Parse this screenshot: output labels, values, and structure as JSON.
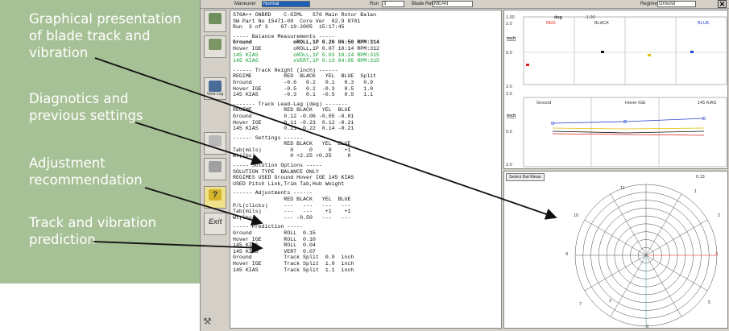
{
  "callouts": {
    "c1_line1": "Graphical presentation",
    "c1_line2": "of blade track and",
    "c1_line3": "vibration",
    "c2_line1": "Diagnotics and",
    "c2_line2": "previous settings",
    "c3_line1": "Adjustment",
    "c3_line2": "recommendation",
    "c4_line1": "Track and vibration",
    "c4_line2": "prediction"
  },
  "toolbar": {
    "maneuver_label": "Maneuver",
    "maneuver_value": "Normal",
    "run_label": "Run",
    "run_value": "3",
    "blade_ref_label": "Blade Ref.",
    "blade_ref_value": "MEAN",
    "regime_label": "Regime",
    "regime_value": "Ground"
  },
  "sidebar": {
    "tools": [
      "",
      "",
      "View Log",
      "",
      "",
      "",
      "Exit"
    ]
  },
  "report": {
    "header1": "S76A++ ONBRD    C-GIML   S76 Main Rotor Balan",
    "header2": "SW Part No 15471-09  Core Ver  02.9 0701",
    "header3": "Run  3 of 3    07-19-2005  15:17:45",
    "bal_title": "----- Balance Measurements -----",
    "bal1": "Ground             oROLL,1P 0.20 06:50 RPM:314",
    "bal2": "Hover IGE          oROLL,1P 0.07 10:14 RPM:312",
    "bal3": "145 KIAS           oROLL,1P 0.03 10:14 RPM:315",
    "bal4": "145 KIAS           xVERT,1P 0.13 04:05 RPM:315",
    "th_title": "------ Track Height (inch) ------",
    "th_hdr": "REGIME          RED  BLACK   YEL  BLUE  Split",
    "th1": "Ground          -0.6   0.2   0.1   0.3   0.9",
    "th2": "Hover IGE       -0.5   0.2  -0.3   0.5   1.0",
    "th3": "145 KIAS        -0.3   0.1  -0.5   0.5   1.1",
    "tl_title": "------- Track Lead-Lag (deg) -------",
    "tl_hdr": "REGIME          RED BLACK   YEL  BLUE",
    "tl1": "Ground          0.12 -0.06 -0.05 -0.01",
    "tl2": "Hover IGE       0.11 -0.23  0.12 -0.21",
    "tl3": "145 KIAS        0.21  0.22  0.14 -0.21",
    "set_title": "------ Settings ------",
    "set_hdr": "                RED BLACK   YEL  BLUE",
    "set1": "Tab(mils)         0     0     0    +1",
    "set2": "Wt(lbs)           0 +2.25 +0.25     0",
    "sol_title": "----- Solution Options -----",
    "sol1": "SOLUTION TYPE  BALANCE ONLY",
    "sol2": "REGIMES USED Ground Hover IGE 145 KIAS",
    "sol3": "USED Pitch Link,Trim Tab,Hub Weight",
    "adj_title": "------ Adjustments ------",
    "adj_hdr": "                RED BLACK   YEL  BLUE",
    "adj1": "P/L(clicks)     ---   ---   ---   ---",
    "adj2": "Tab(mils)       ---   ---    +1    +1",
    "adj3": "Wt(lbs)         --- -0.50   ---   ---",
    "pred_title": "----- Prediction -----",
    "p1": "Ground          ROLL  0.15",
    "p2": "Hover IGE       ROLL  0.10",
    "p3": "145 KIAS        ROLL  0.04",
    "p4": "145 KIAS        VERT  0.07",
    "p5": "Ground          Track Split  0.9  inch",
    "p6": "Hover IGE       Track Split  1.0  inch",
    "p7": "145 KIAS        Track Split  1.1  inch"
  },
  "chart": {
    "deg_label": "deg",
    "top_left_val": "1.00",
    "top_mid_val": "-1.00",
    "red": "RED",
    "black": "BLACK",
    "blue": "BLUE",
    "inch1": "inch",
    "inch2": "inch",
    "y_top": "2.0",
    "y_mid": "0.0",
    "y_bot": "2.0",
    "y2_top": "2.0",
    "y2_mid": "0.0",
    "y2_bot": "2.0",
    "x_ground": "Ground",
    "x_hover": "Hover IGE",
    "x_145": "145 KIAS",
    "colors": {
      "red": "#e02020",
      "black": "#111111",
      "yellow": "#e0c000",
      "blue": "#2040d0"
    }
  },
  "polar": {
    "select_btn": "Select Bal Meas",
    "top_val": "0.13",
    "label_11": "11",
    "label_1": "1",
    "label_10": "10",
    "label_2": "2",
    "label_9": "9",
    "label_3": "3",
    "label_5": "5",
    "label_7": "7",
    "label_6": "6",
    "marker": "2"
  }
}
